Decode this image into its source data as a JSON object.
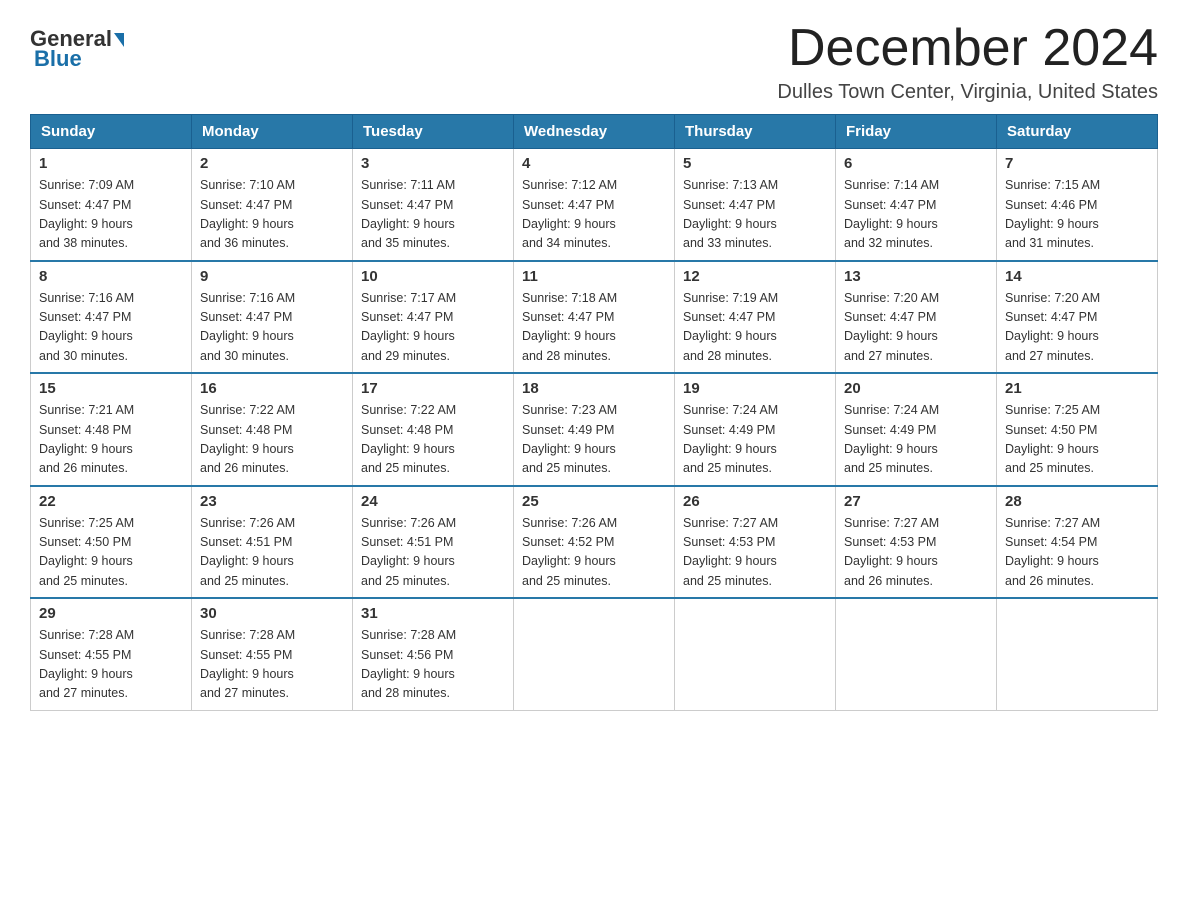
{
  "header": {
    "logo_general": "General",
    "logo_blue": "Blue",
    "month_title": "December 2024",
    "location": "Dulles Town Center, Virginia, United States"
  },
  "days_of_week": [
    "Sunday",
    "Monday",
    "Tuesday",
    "Wednesday",
    "Thursday",
    "Friday",
    "Saturday"
  ],
  "weeks": [
    [
      {
        "day": "1",
        "sunrise": "7:09 AM",
        "sunset": "4:47 PM",
        "daylight": "9 hours and 38 minutes."
      },
      {
        "day": "2",
        "sunrise": "7:10 AM",
        "sunset": "4:47 PM",
        "daylight": "9 hours and 36 minutes."
      },
      {
        "day": "3",
        "sunrise": "7:11 AM",
        "sunset": "4:47 PM",
        "daylight": "9 hours and 35 minutes."
      },
      {
        "day": "4",
        "sunrise": "7:12 AM",
        "sunset": "4:47 PM",
        "daylight": "9 hours and 34 minutes."
      },
      {
        "day": "5",
        "sunrise": "7:13 AM",
        "sunset": "4:47 PM",
        "daylight": "9 hours and 33 minutes."
      },
      {
        "day": "6",
        "sunrise": "7:14 AM",
        "sunset": "4:47 PM",
        "daylight": "9 hours and 32 minutes."
      },
      {
        "day": "7",
        "sunrise": "7:15 AM",
        "sunset": "4:46 PM",
        "daylight": "9 hours and 31 minutes."
      }
    ],
    [
      {
        "day": "8",
        "sunrise": "7:16 AM",
        "sunset": "4:47 PM",
        "daylight": "9 hours and 30 minutes."
      },
      {
        "day": "9",
        "sunrise": "7:16 AM",
        "sunset": "4:47 PM",
        "daylight": "9 hours and 30 minutes."
      },
      {
        "day": "10",
        "sunrise": "7:17 AM",
        "sunset": "4:47 PM",
        "daylight": "9 hours and 29 minutes."
      },
      {
        "day": "11",
        "sunrise": "7:18 AM",
        "sunset": "4:47 PM",
        "daylight": "9 hours and 28 minutes."
      },
      {
        "day": "12",
        "sunrise": "7:19 AM",
        "sunset": "4:47 PM",
        "daylight": "9 hours and 28 minutes."
      },
      {
        "day": "13",
        "sunrise": "7:20 AM",
        "sunset": "4:47 PM",
        "daylight": "9 hours and 27 minutes."
      },
      {
        "day": "14",
        "sunrise": "7:20 AM",
        "sunset": "4:47 PM",
        "daylight": "9 hours and 27 minutes."
      }
    ],
    [
      {
        "day": "15",
        "sunrise": "7:21 AM",
        "sunset": "4:48 PM",
        "daylight": "9 hours and 26 minutes."
      },
      {
        "day": "16",
        "sunrise": "7:22 AM",
        "sunset": "4:48 PM",
        "daylight": "9 hours and 26 minutes."
      },
      {
        "day": "17",
        "sunrise": "7:22 AM",
        "sunset": "4:48 PM",
        "daylight": "9 hours and 25 minutes."
      },
      {
        "day": "18",
        "sunrise": "7:23 AM",
        "sunset": "4:49 PM",
        "daylight": "9 hours and 25 minutes."
      },
      {
        "day": "19",
        "sunrise": "7:24 AM",
        "sunset": "4:49 PM",
        "daylight": "9 hours and 25 minutes."
      },
      {
        "day": "20",
        "sunrise": "7:24 AM",
        "sunset": "4:49 PM",
        "daylight": "9 hours and 25 minutes."
      },
      {
        "day": "21",
        "sunrise": "7:25 AM",
        "sunset": "4:50 PM",
        "daylight": "9 hours and 25 minutes."
      }
    ],
    [
      {
        "day": "22",
        "sunrise": "7:25 AM",
        "sunset": "4:50 PM",
        "daylight": "9 hours and 25 minutes."
      },
      {
        "day": "23",
        "sunrise": "7:26 AM",
        "sunset": "4:51 PM",
        "daylight": "9 hours and 25 minutes."
      },
      {
        "day": "24",
        "sunrise": "7:26 AM",
        "sunset": "4:51 PM",
        "daylight": "9 hours and 25 minutes."
      },
      {
        "day": "25",
        "sunrise": "7:26 AM",
        "sunset": "4:52 PM",
        "daylight": "9 hours and 25 minutes."
      },
      {
        "day": "26",
        "sunrise": "7:27 AM",
        "sunset": "4:53 PM",
        "daylight": "9 hours and 25 minutes."
      },
      {
        "day": "27",
        "sunrise": "7:27 AM",
        "sunset": "4:53 PM",
        "daylight": "9 hours and 26 minutes."
      },
      {
        "day": "28",
        "sunrise": "7:27 AM",
        "sunset": "4:54 PM",
        "daylight": "9 hours and 26 minutes."
      }
    ],
    [
      {
        "day": "29",
        "sunrise": "7:28 AM",
        "sunset": "4:55 PM",
        "daylight": "9 hours and 27 minutes."
      },
      {
        "day": "30",
        "sunrise": "7:28 AM",
        "sunset": "4:55 PM",
        "daylight": "9 hours and 27 minutes."
      },
      {
        "day": "31",
        "sunrise": "7:28 AM",
        "sunset": "4:56 PM",
        "daylight": "9 hours and 28 minutes."
      },
      null,
      null,
      null,
      null
    ]
  ],
  "labels": {
    "sunrise": "Sunrise:",
    "sunset": "Sunset:",
    "daylight": "Daylight:"
  }
}
